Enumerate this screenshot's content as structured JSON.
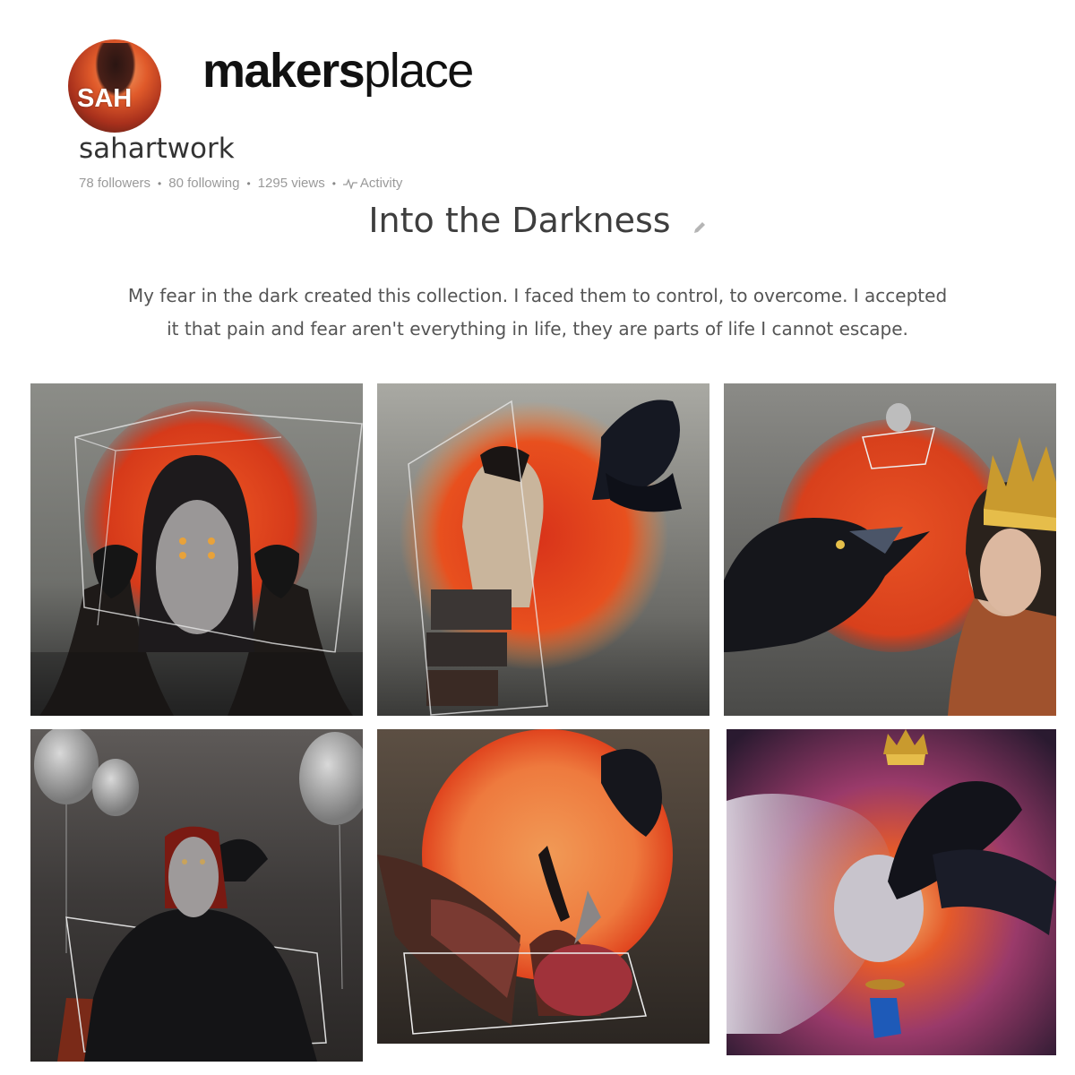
{
  "profile": {
    "avatar_initials": "SAH",
    "username": "sahartwork",
    "followers": "78 followers",
    "following": "80 following",
    "views": "1295 views",
    "activity_label": "Activity",
    "activity_icon": "activity-pulse-icon"
  },
  "brand": {
    "name_bold": "makers",
    "name_light": "place"
  },
  "collection": {
    "title": "Into the Darkness",
    "edit_icon": "pencil-icon",
    "description_line1": "My fear in the dark created this collection. I faced them to control, to overcome. I accepted",
    "description_line2": "it that pain and fear aren't everything in life, they are parts of life I cannot escape."
  },
  "artworks": [
    {
      "subject": "masked figure with two crows and red sun"
    },
    {
      "subject": "figure on stacked blocks with crow and red sun"
    },
    {
      "subject": "crow facing crowned woman, balloon in box"
    },
    {
      "subject": "red-haired masked figure with crow and balloons"
    },
    {
      "subject": "winged figure with crow and orange sun"
    },
    {
      "subject": "crowned crow and face in purple haze"
    }
  ],
  "colors": {
    "sun_red": "#e0441e",
    "sun_orange": "#f08a3c",
    "crow_black": "#15161c",
    "mist_gray": "#8a8a86"
  }
}
